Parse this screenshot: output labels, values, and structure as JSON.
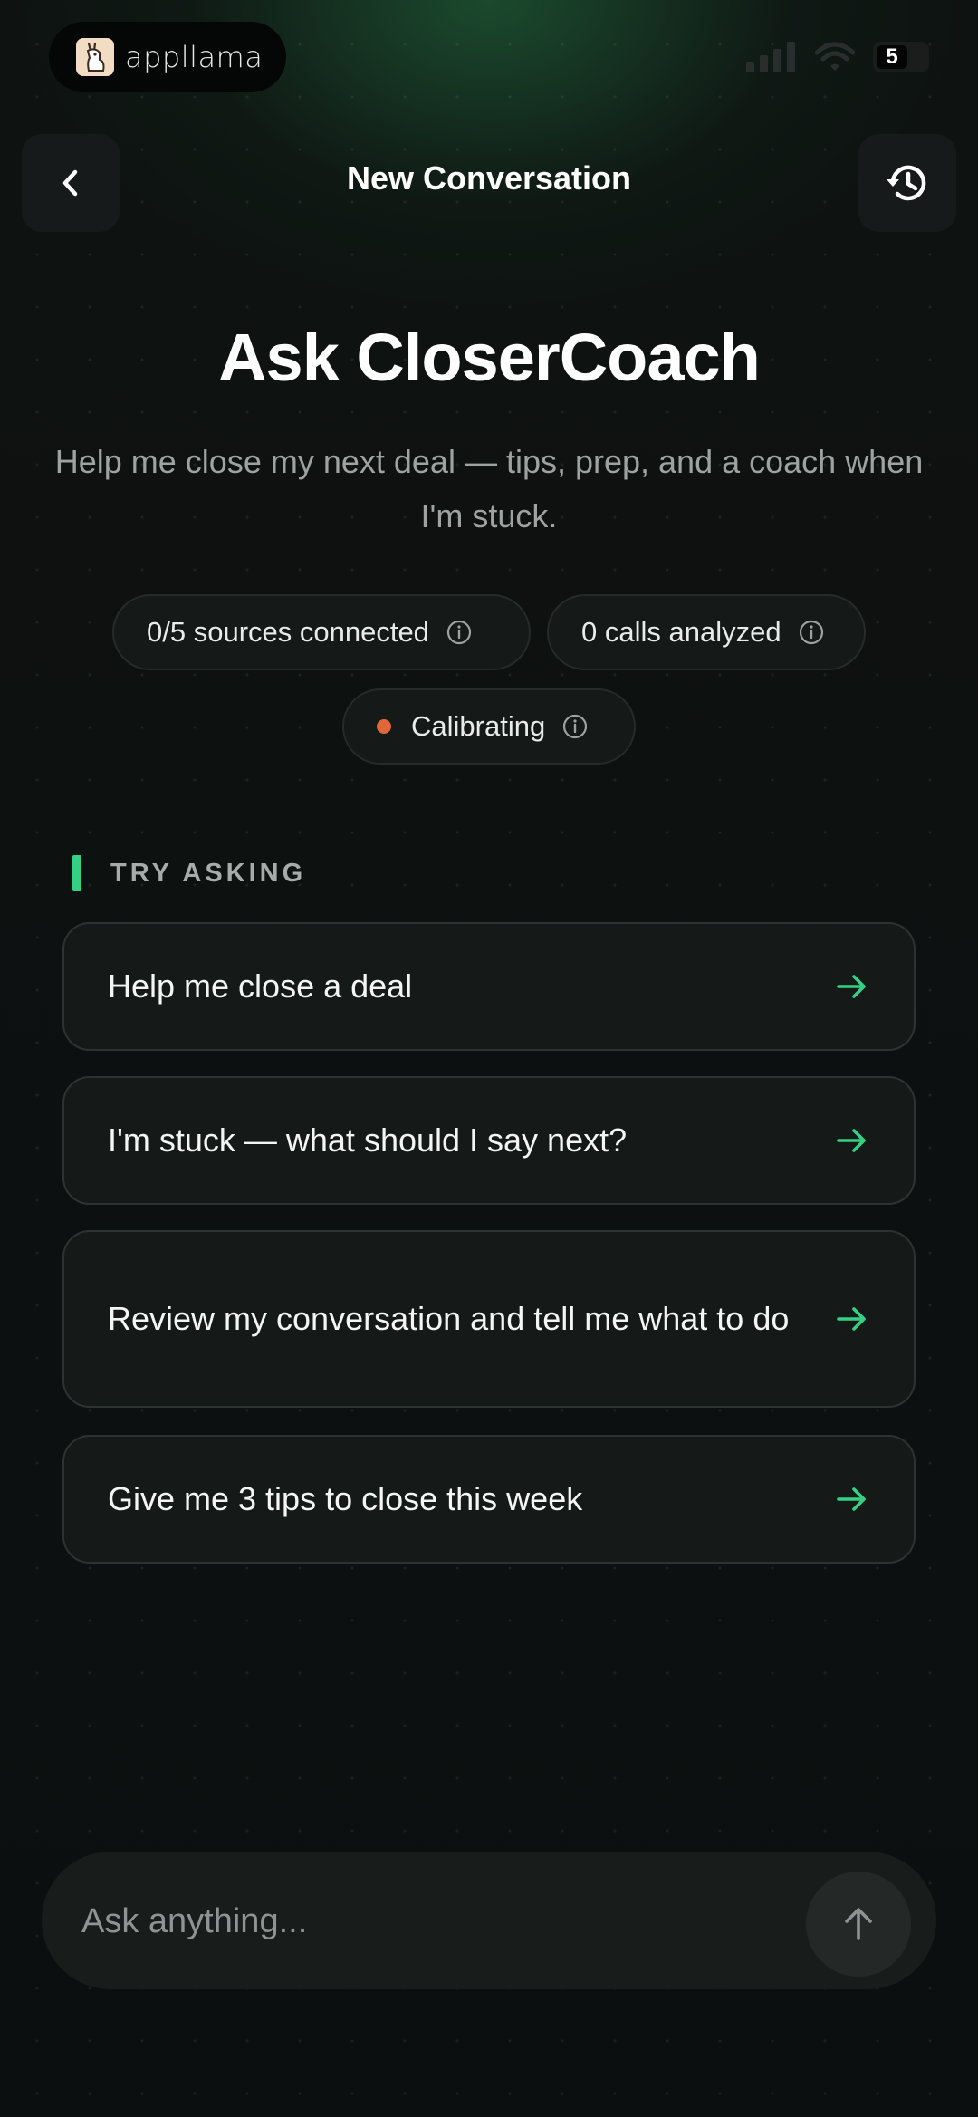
{
  "status_bar": {
    "app_badge_label": "appllama",
    "battery_level": "5"
  },
  "header": {
    "title": "New Conversation"
  },
  "hero": {
    "title": "Ask CloserCoach",
    "subtitle": "Help me close my next deal — tips, prep, and a coach when I'm stuck."
  },
  "stats": {
    "sources": "0/5 sources connected",
    "calls": "0 calls analyzed",
    "status": "Calibrating",
    "status_color": "#e0673a"
  },
  "suggestions": {
    "section_label": "TRY ASKING",
    "items": [
      {
        "label": "Help me close a deal"
      },
      {
        "label": "I'm stuck — what should I say next?"
      },
      {
        "label": "Review my conversation and tell me what to do"
      },
      {
        "label": "Give me 3 tips to close this week"
      }
    ]
  },
  "composer": {
    "placeholder": "Ask anything..."
  },
  "colors": {
    "accent": "#34d184",
    "background": "#0d1010",
    "card": "#151918"
  }
}
